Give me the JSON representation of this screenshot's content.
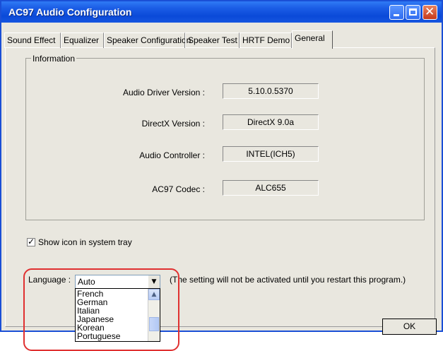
{
  "window": {
    "title": "AC97 Audio Configuration"
  },
  "tabs": [
    {
      "label": "Sound Effect"
    },
    {
      "label": "Equalizer"
    },
    {
      "label": "Speaker Configuration"
    },
    {
      "label": "Speaker Test"
    },
    {
      "label": "HRTF Demo"
    },
    {
      "label": "General"
    }
  ],
  "info": {
    "group_label": "Information",
    "rows": [
      {
        "label": "Audio Driver Version :",
        "value": "5.10.0.5370"
      },
      {
        "label": "DirectX Version :",
        "value": "DirectX 9.0a"
      },
      {
        "label": "Audio Controller :",
        "value": "INTEL(ICH5)"
      },
      {
        "label": "AC97 Codec :",
        "value": "ALC655"
      }
    ]
  },
  "tray": {
    "label": "Show icon in system tray",
    "checked": true
  },
  "language": {
    "label": "Language :",
    "selected": "Auto",
    "note": "(The setting will not be activated until you restart this program.)",
    "options": [
      "French",
      "German",
      "Italian",
      "Japanese",
      "Korean",
      "Portuguese"
    ]
  },
  "ok_label": "OK",
  "colors": {
    "title_bar": "#0a49d8",
    "annotation": "#e03030",
    "face": "#e9e7df"
  }
}
